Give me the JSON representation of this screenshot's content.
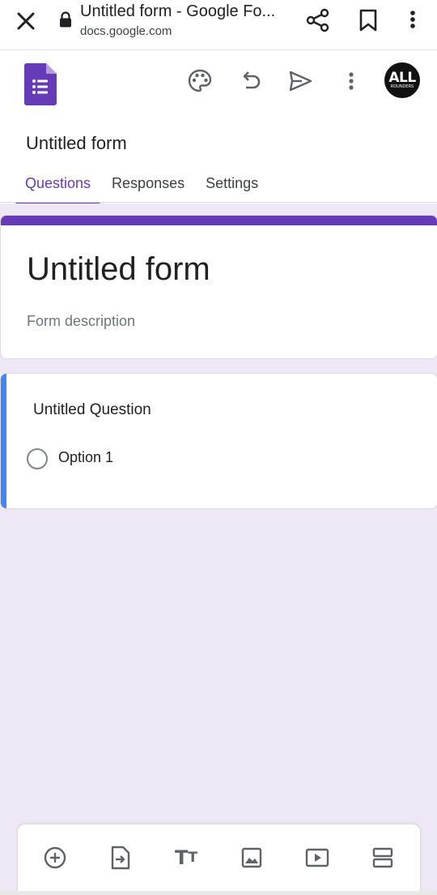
{
  "browser": {
    "page_title": "Untitled form - Google Fo...",
    "url": "docs.google.com"
  },
  "header": {
    "avatar_text_line1": "ALL",
    "avatar_text_line2": "ROUNDERS",
    "form_name": "Untitled form",
    "tabs": [
      {
        "label": "Questions",
        "active": true
      },
      {
        "label": "Responses",
        "active": false
      },
      {
        "label": "Settings",
        "active": false
      }
    ]
  },
  "form": {
    "title": "Untitled form",
    "description_placeholder": "Form description",
    "questions": [
      {
        "title": "Untitled Question",
        "options": [
          "Option 1"
        ]
      }
    ]
  },
  "icons": {
    "close": "close-icon",
    "lock": "lock-icon",
    "share": "share-icon",
    "bookmark": "bookmark-icon",
    "more": "more-vert-icon",
    "forms_logo": "google-forms-logo",
    "palette": "palette-icon",
    "undo": "undo-icon",
    "send": "send-icon",
    "toolbar": [
      "add-circle-icon",
      "import-questions-icon",
      "text-icon",
      "image-icon",
      "video-icon",
      "section-icon"
    ]
  },
  "colors": {
    "accent": "#673ab7",
    "active_card_bar": "#4285f4",
    "canvas_background": "#ede7f6",
    "icon_gray": "#5f6368"
  }
}
